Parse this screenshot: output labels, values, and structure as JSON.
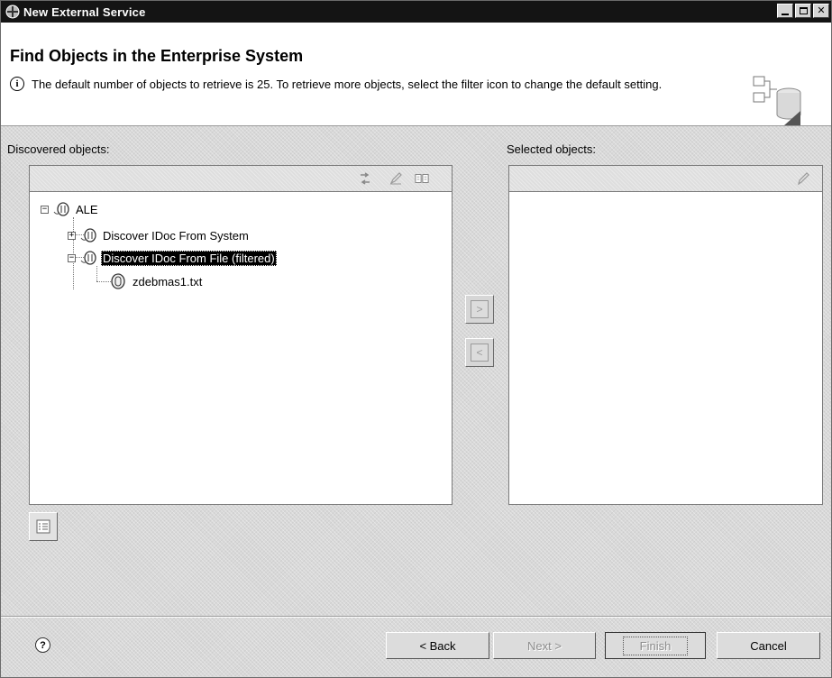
{
  "window": {
    "title": "New External Service"
  },
  "header": {
    "heading": "Find Objects in the Enterprise System",
    "message": "The default number of objects to retrieve is 25. To retrieve more objects, select the filter icon to change the default setting."
  },
  "discovered": {
    "label": "Discovered objects:",
    "toolbar_icons": [
      "refresh-icon",
      "edit-icon",
      "book-icon"
    ],
    "tree": [
      {
        "label": "ALE",
        "expander": "−",
        "level": 0
      },
      {
        "label": "Discover IDoc From System",
        "expander": "+",
        "level": 1
      },
      {
        "label": "Discover IDoc From File (filtered)",
        "expander": "−",
        "level": 1,
        "selected": true
      },
      {
        "label": "zdebmas1.txt",
        "level": 2
      }
    ]
  },
  "selected": {
    "label": "Selected objects:",
    "toolbar_icons": [
      "edit-icon"
    ]
  },
  "transfer": {
    "add_label": ">",
    "remove_label": "<"
  },
  "footer": {
    "help_label": "?",
    "back_label": "< Back",
    "next_label": "Next >",
    "finish_label": "Finish",
    "cancel_label": "Cancel"
  }
}
